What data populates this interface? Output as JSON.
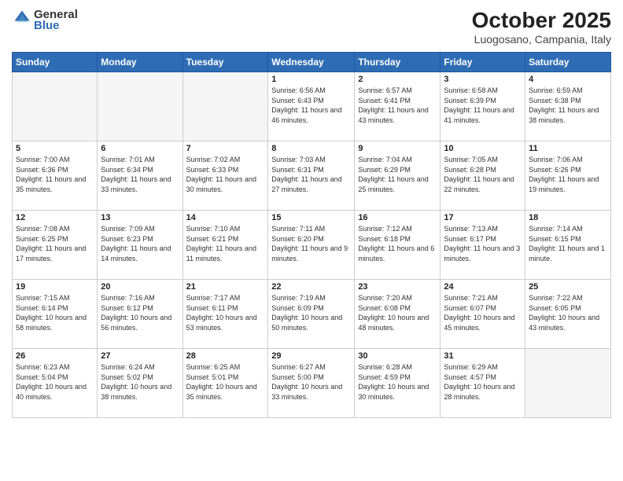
{
  "logo": {
    "general": "General",
    "blue": "Blue"
  },
  "title": "October 2025",
  "subtitle": "Luogosano, Campania, Italy",
  "days_of_week": [
    "Sunday",
    "Monday",
    "Tuesday",
    "Wednesday",
    "Thursday",
    "Friday",
    "Saturday"
  ],
  "weeks": [
    [
      {
        "day": "",
        "info": ""
      },
      {
        "day": "",
        "info": ""
      },
      {
        "day": "",
        "info": ""
      },
      {
        "day": "1",
        "info": "Sunrise: 6:56 AM\nSunset: 6:43 PM\nDaylight: 11 hours and 46 minutes."
      },
      {
        "day": "2",
        "info": "Sunrise: 6:57 AM\nSunset: 6:41 PM\nDaylight: 11 hours and 43 minutes."
      },
      {
        "day": "3",
        "info": "Sunrise: 6:58 AM\nSunset: 6:39 PM\nDaylight: 11 hours and 41 minutes."
      },
      {
        "day": "4",
        "info": "Sunrise: 6:59 AM\nSunset: 6:38 PM\nDaylight: 11 hours and 38 minutes."
      }
    ],
    [
      {
        "day": "5",
        "info": "Sunrise: 7:00 AM\nSunset: 6:36 PM\nDaylight: 11 hours and 35 minutes."
      },
      {
        "day": "6",
        "info": "Sunrise: 7:01 AM\nSunset: 6:34 PM\nDaylight: 11 hours and 33 minutes."
      },
      {
        "day": "7",
        "info": "Sunrise: 7:02 AM\nSunset: 6:33 PM\nDaylight: 11 hours and 30 minutes."
      },
      {
        "day": "8",
        "info": "Sunrise: 7:03 AM\nSunset: 6:31 PM\nDaylight: 11 hours and 27 minutes."
      },
      {
        "day": "9",
        "info": "Sunrise: 7:04 AM\nSunset: 6:29 PM\nDaylight: 11 hours and 25 minutes."
      },
      {
        "day": "10",
        "info": "Sunrise: 7:05 AM\nSunset: 6:28 PM\nDaylight: 11 hours and 22 minutes."
      },
      {
        "day": "11",
        "info": "Sunrise: 7:06 AM\nSunset: 6:26 PM\nDaylight: 11 hours and 19 minutes."
      }
    ],
    [
      {
        "day": "12",
        "info": "Sunrise: 7:08 AM\nSunset: 6:25 PM\nDaylight: 11 hours and 17 minutes."
      },
      {
        "day": "13",
        "info": "Sunrise: 7:09 AM\nSunset: 6:23 PM\nDaylight: 11 hours and 14 minutes."
      },
      {
        "day": "14",
        "info": "Sunrise: 7:10 AM\nSunset: 6:21 PM\nDaylight: 11 hours and 11 minutes."
      },
      {
        "day": "15",
        "info": "Sunrise: 7:11 AM\nSunset: 6:20 PM\nDaylight: 11 hours and 9 minutes."
      },
      {
        "day": "16",
        "info": "Sunrise: 7:12 AM\nSunset: 6:18 PM\nDaylight: 11 hours and 6 minutes."
      },
      {
        "day": "17",
        "info": "Sunrise: 7:13 AM\nSunset: 6:17 PM\nDaylight: 11 hours and 3 minutes."
      },
      {
        "day": "18",
        "info": "Sunrise: 7:14 AM\nSunset: 6:15 PM\nDaylight: 11 hours and 1 minute."
      }
    ],
    [
      {
        "day": "19",
        "info": "Sunrise: 7:15 AM\nSunset: 6:14 PM\nDaylight: 10 hours and 58 minutes."
      },
      {
        "day": "20",
        "info": "Sunrise: 7:16 AM\nSunset: 6:12 PM\nDaylight: 10 hours and 56 minutes."
      },
      {
        "day": "21",
        "info": "Sunrise: 7:17 AM\nSunset: 6:11 PM\nDaylight: 10 hours and 53 minutes."
      },
      {
        "day": "22",
        "info": "Sunrise: 7:19 AM\nSunset: 6:09 PM\nDaylight: 10 hours and 50 minutes."
      },
      {
        "day": "23",
        "info": "Sunrise: 7:20 AM\nSunset: 6:08 PM\nDaylight: 10 hours and 48 minutes."
      },
      {
        "day": "24",
        "info": "Sunrise: 7:21 AM\nSunset: 6:07 PM\nDaylight: 10 hours and 45 minutes."
      },
      {
        "day": "25",
        "info": "Sunrise: 7:22 AM\nSunset: 6:05 PM\nDaylight: 10 hours and 43 minutes."
      }
    ],
    [
      {
        "day": "26",
        "info": "Sunrise: 6:23 AM\nSunset: 5:04 PM\nDaylight: 10 hours and 40 minutes."
      },
      {
        "day": "27",
        "info": "Sunrise: 6:24 AM\nSunset: 5:02 PM\nDaylight: 10 hours and 38 minutes."
      },
      {
        "day": "28",
        "info": "Sunrise: 6:25 AM\nSunset: 5:01 PM\nDaylight: 10 hours and 35 minutes."
      },
      {
        "day": "29",
        "info": "Sunrise: 6:27 AM\nSunset: 5:00 PM\nDaylight: 10 hours and 33 minutes."
      },
      {
        "day": "30",
        "info": "Sunrise: 6:28 AM\nSunset: 4:59 PM\nDaylight: 10 hours and 30 minutes."
      },
      {
        "day": "31",
        "info": "Sunrise: 6:29 AM\nSunset: 4:57 PM\nDaylight: 10 hours and 28 minutes."
      },
      {
        "day": "",
        "info": ""
      }
    ]
  ]
}
